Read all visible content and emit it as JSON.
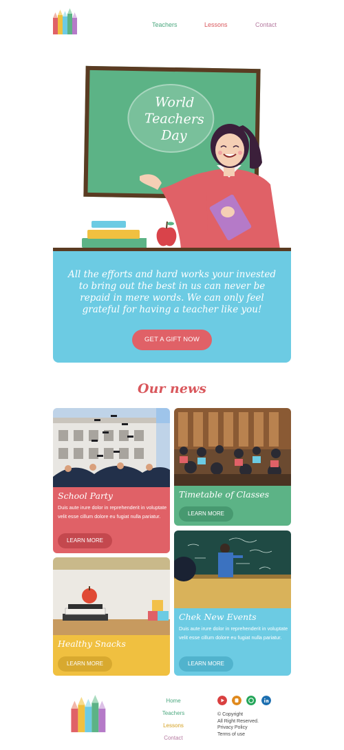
{
  "header": {
    "logo_icon": "pencils-logo",
    "nav": [
      {
        "label": "Teachers",
        "color": "#4aa77e"
      },
      {
        "label": "Lessons",
        "color": "#d9575c"
      },
      {
        "label": "Contact",
        "color": "#b57aa0"
      }
    ]
  },
  "hero": {
    "board_lines": [
      "World",
      "Teachers",
      "Day"
    ],
    "message": "All the efforts and hard works your invested to bring out the best in us can never be repaid in mere words. We can only feel grateful for having a teacher like you!",
    "button_label": "GET A GIFT NOW"
  },
  "news": {
    "title": "Our news",
    "cards": [
      {
        "title": "School Party",
        "text": "Duis aute irure dolor in reprehenderit in voluptate velit esse cillum dolore eu fugiat nulla pariatur.",
        "button": "LEARN MORE",
        "color": "#e06167"
      },
      {
        "title": "Timetable of Classes",
        "text": "",
        "button": "LEARN MORE",
        "color": "#5cb386"
      },
      {
        "title": "Healthy Snacks",
        "text": "",
        "button": "LEARN MORE",
        "color": "#f0c040"
      },
      {
        "title": "Chek New Events",
        "text": "Duis aute irure dolor in reprehenderit in voluptate velit esse cillum dolore eu fugiat nulla pariatur.",
        "button": "LEARN MORE",
        "color": "#6ccbe3"
      }
    ]
  },
  "footer": {
    "links": [
      {
        "label": "Home",
        "color": "#4aa77e"
      },
      {
        "label": "Teachers",
        "color": "#4aa77e"
      },
      {
        "label": "Lessons",
        "color": "#d4a020"
      },
      {
        "label": "Contact",
        "color": "#b57aa0"
      }
    ],
    "social": [
      {
        "icon": "youtube-icon",
        "color": "#d94040"
      },
      {
        "icon": "blogger-icon",
        "color": "#e08a1e"
      },
      {
        "icon": "whatsapp-icon",
        "color": "#25a65a"
      },
      {
        "icon": "linkedin-icon",
        "color": "#1c6fb0"
      }
    ],
    "copyright": "© Copyright",
    "rights": "All Right Reserved.",
    "privacy": "Privacy Policy",
    "terms": "Terms of use"
  }
}
